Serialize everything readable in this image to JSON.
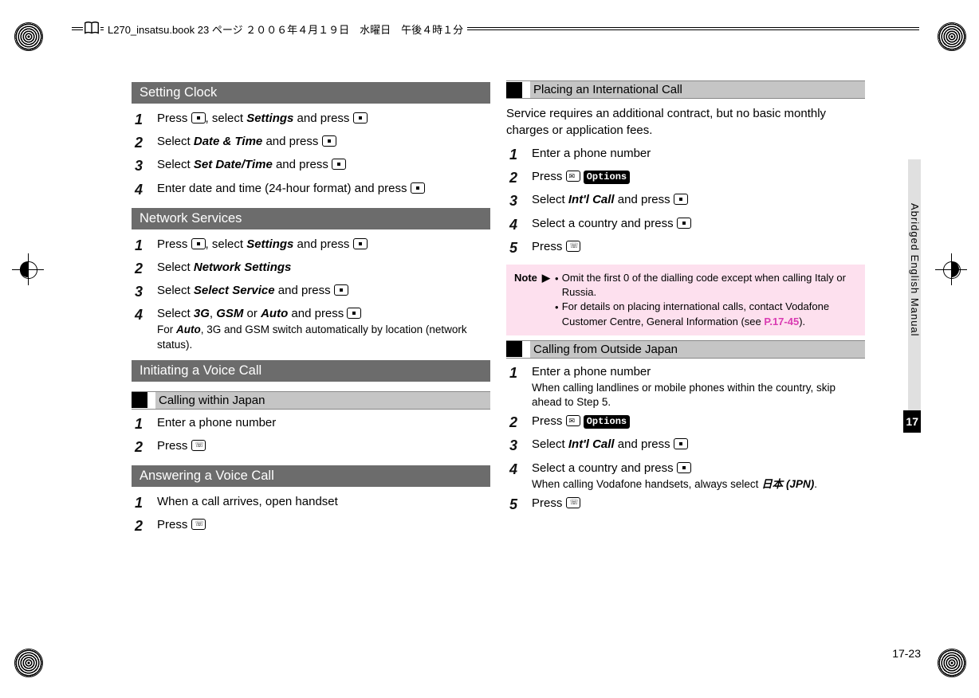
{
  "header": {
    "filename": "L270_insatsu.book 23 ページ ２００６年４月１９日　水曜日　午後４時１分"
  },
  "left": {
    "s1": {
      "title": "Setting Clock",
      "steps": {
        "1a": "Press ",
        "1b": ", select ",
        "1c": "Settings",
        "1d": " and press ",
        "2a": "Select ",
        "2b": "Date & Time",
        "2c": " and press ",
        "3a": "Select ",
        "3b": "Set Date/Time",
        "3c": " and press ",
        "4a": "Enter date and time (24-hour format) and press "
      }
    },
    "s2": {
      "title": "Network Services",
      "steps": {
        "1a": "Press ",
        "1b": ", select ",
        "1c": "Settings",
        "1d": " and press ",
        "2a": "Select ",
        "2b": "Network Settings",
        "3a": "Select ",
        "3b": "Select Service",
        "3c": " and press ",
        "4a": "Select ",
        "4b": "3G",
        "4c": ", ",
        "4d": "GSM",
        "4e": " or ",
        "4f": "Auto",
        "4g": " and press ",
        "4sub_a": "For ",
        "4sub_b": "Auto",
        "4sub_c": ", 3G and GSM switch automatically by location (network status)."
      }
    },
    "s3": {
      "title": "Initiating a Voice Call",
      "sub1": "Calling within Japan",
      "steps": {
        "1": "Enter a phone number",
        "2": "Press "
      }
    },
    "s4": {
      "title": "Answering a Voice Call",
      "steps": {
        "1": "When a call arrives, open handset",
        "2": "Press "
      }
    }
  },
  "right": {
    "sub1": "Placing an International Call",
    "intro": "Service requires an additional contract, but no basic monthly charges or application fees.",
    "s1_steps": {
      "1": "Enter a phone number",
      "2a": "Press ",
      "2b": "Options",
      "3a": "Select ",
      "3b": "Int'l Call",
      "3c": " and press ",
      "4": "Select a country and press ",
      "5": "Press "
    },
    "note": {
      "label": "Note",
      "b1": "Omit the first 0 of the dialling code except when calling Italy or Russia.",
      "b2a": "For details on placing international calls, contact Vodafone Customer Centre, General Information (see ",
      "b2b": "P.17-45",
      "b2c": ")."
    },
    "sub2": "Calling from Outside Japan",
    "s2_steps": {
      "1a": "Enter a phone number",
      "1sub": "When calling landlines or mobile phones within the country, skip ahead to Step 5.",
      "2a": "Press ",
      "2b": "Options",
      "3a": "Select ",
      "3b": "Int'l Call",
      "3c": " and press ",
      "4a": "Select a country and press ",
      "4sub_a": "When calling Vodafone handsets, always select ",
      "4sub_b": "日本 (JPN)",
      "4sub_c": ".",
      "5": "Press "
    }
  },
  "side": {
    "label": "Abridged English Manual",
    "tab": "17"
  },
  "page_num": "17-23"
}
